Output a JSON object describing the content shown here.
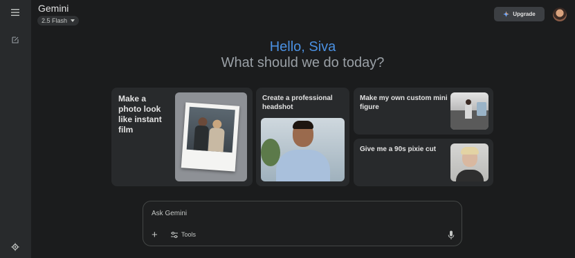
{
  "sidebar": {
    "menu_icon": "menu-icon",
    "new_chat_icon": "edit-icon",
    "settings_icon": "gear-icon"
  },
  "header": {
    "title": "Gemini",
    "model": "2.5 Flash",
    "upgrade_label": "Upgrade"
  },
  "greeting": {
    "hello": "Hello, Siva",
    "prompt": "What should we do today?"
  },
  "cards": [
    {
      "label": "Make a photo look like instant film"
    },
    {
      "label": "Create a professional headshot"
    },
    {
      "label": "Make my own custom mini figure"
    },
    {
      "label": "Give me a 90s pixie cut"
    }
  ],
  "composer": {
    "placeholder": "Ask Gemini",
    "tools_label": "Tools"
  },
  "colors": {
    "accent": "#4a90e2",
    "background": "#1b1c1d",
    "card": "#282a2c"
  }
}
